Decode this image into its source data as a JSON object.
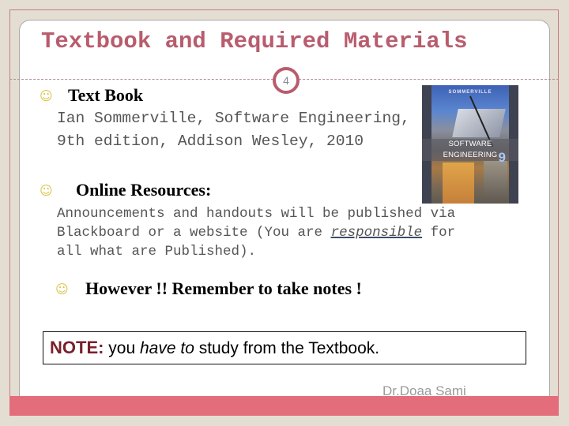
{
  "slide": {
    "title": "Textbook and Required Materials",
    "page_number": "4",
    "footer": "Dr.Doaa Sami"
  },
  "textbook": {
    "heading": "Text Book",
    "line1": "Ian Sommerville, Software Engineering,",
    "line2": "9th edition, Addison Wesley, 2010",
    "cover": {
      "author": "SOMMERVILLE",
      "title": "SOFTWARE ENGINEERING",
      "edition": "9"
    }
  },
  "online": {
    "heading": "Online Resources:",
    "line1": "Announcements and handouts will be published via",
    "line2_pre": "Blackboard or a website (You are ",
    "line2_emph": "responsible",
    "line2_post": " for",
    "line3": "all what are Published)."
  },
  "reminder": {
    "text": "However  !! Remember to take notes !"
  },
  "note": {
    "label": "NOTE:",
    "pre": " you ",
    "emph": "have to",
    "post": " study from the Textbook."
  },
  "colors": {
    "accent": "#b85c6e",
    "bar": "#e46d7b",
    "note_label": "#7a1f2b",
    "bullet": "#d8c548"
  }
}
